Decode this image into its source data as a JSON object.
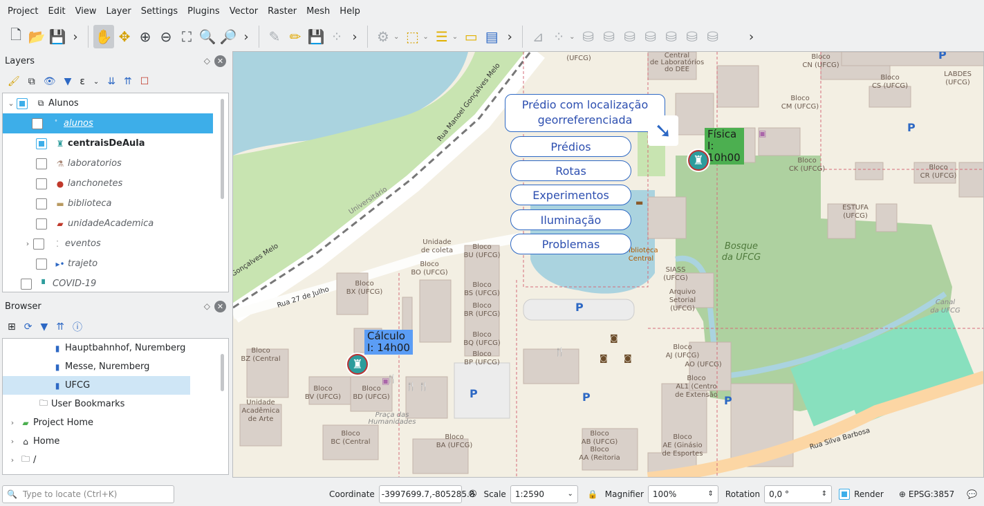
{
  "menubar": {
    "items": [
      "Project",
      "Edit",
      "View",
      "Layer",
      "Settings",
      "Plugins",
      "Vector",
      "Raster",
      "Mesh",
      "Help"
    ]
  },
  "layers_panel": {
    "title": "Layers",
    "items": [
      {
        "label": "Alunos",
        "style": "normal"
      },
      {
        "label": "alunos",
        "style": "italic-link"
      },
      {
        "label": "centraisDeAula",
        "style": "bold"
      },
      {
        "label": "laboratorios",
        "style": "italic"
      },
      {
        "label": "lanchonetes",
        "style": "italic"
      },
      {
        "label": "biblioteca",
        "style": "italic"
      },
      {
        "label": "unidadeAcademica",
        "style": "italic"
      },
      {
        "label": "eventos",
        "style": "italic"
      },
      {
        "label": "trajeto",
        "style": "italic"
      },
      {
        "label": "COVID-19",
        "style": "italic"
      }
    ]
  },
  "browser_panel": {
    "title": "Browser",
    "items": [
      {
        "label": "Hauptbahnhof, Nuremberg"
      },
      {
        "label": "Messe, Nuremberg"
      },
      {
        "label": "UFCG"
      },
      {
        "label": "User Bookmarks"
      },
      {
        "label": "Project Home"
      },
      {
        "label": "Home"
      },
      {
        "label": "/"
      }
    ]
  },
  "map": {
    "callout": "Prédio com localização georreferenciada",
    "buttons": [
      "Prédios",
      "Rotas",
      "Experimentos",
      "Iluminação",
      "Problemas"
    ],
    "labels": [
      {
        "text": "Física I: 10h00",
        "color": "#4caf50"
      },
      {
        "text": "Cálculo I: 14h00",
        "color": "#5b9df5"
      }
    ],
    "street_names": [
      "Rua 27 de Julho",
      "Rua Manoel Gonçalves Melo",
      "Rua Silva Barbosa",
      "Universitário",
      "Bosque da UFCG"
    ]
  },
  "statusbar": {
    "locate_placeholder": "Type to locate (Ctrl+K)",
    "coordinate_label": "Coordinate",
    "coordinate_value": "-3997699.7,-805285.8",
    "scale_label": "Scale",
    "scale_value": "1:2590",
    "magnifier_label": "Magnifier",
    "magnifier_value": "100%",
    "rotation_label": "Rotation",
    "rotation_value": "0,0 °",
    "render_label": "Render",
    "crs": "EPSG:3857"
  }
}
